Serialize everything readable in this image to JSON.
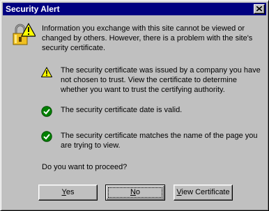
{
  "window": {
    "title": "Security Alert",
    "close_icon": "close-icon",
    "lock_icon": "warning-lock-icon"
  },
  "intro": "Information you exchange with this site cannot be viewed or changed by others. However, there is a problem with the site's security certificate.",
  "items": [
    {
      "icon": "warning-icon",
      "text": "The security certificate was issued by a company you have not chosen to trust. View the certificate to determine whether you want to trust the certifying authority."
    },
    {
      "icon": "check-icon",
      "text": "The security certificate date is valid."
    },
    {
      "icon": "check-icon",
      "text": "The security certificate matches the name of the page you are trying to view."
    }
  ],
  "question": "Do you want to proceed?",
  "buttons": {
    "yes": {
      "label": "Yes",
      "accel": "Y",
      "rest": "es"
    },
    "no": {
      "label": "No",
      "accel": "N",
      "rest": "o"
    },
    "view": {
      "label": "View Certificate",
      "accel": "V",
      "rest": "iew Certificate"
    }
  },
  "colors": {
    "titlebar": "#000080",
    "face": "#c0c0c0",
    "check": "#008000",
    "warning": "#ffff00"
  }
}
